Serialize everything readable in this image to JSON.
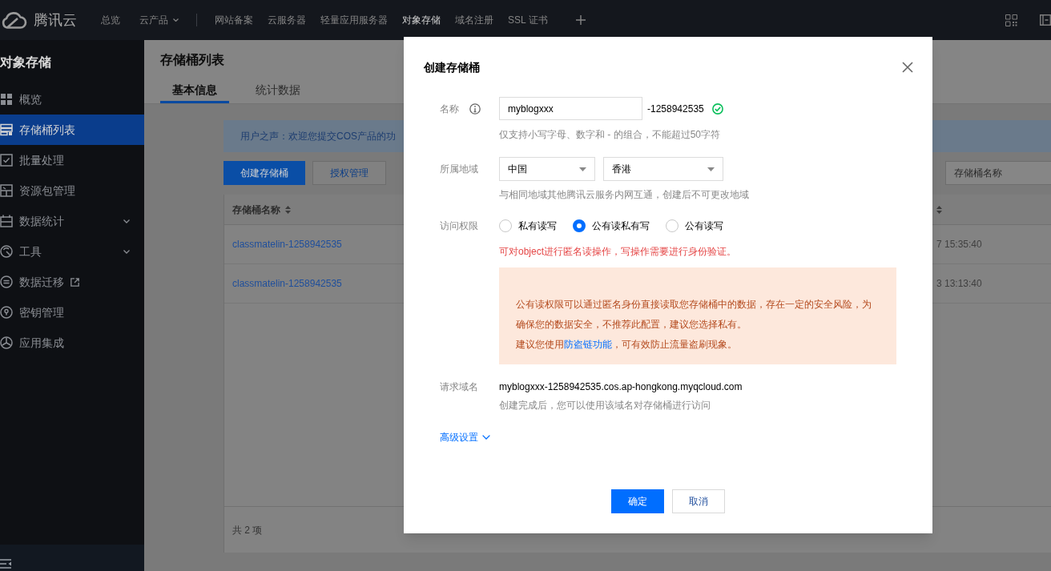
{
  "top_nav": {
    "logo": "腾讯云",
    "groups": [
      [
        {
          "label": "总览",
          "kind": "link",
          "selected": false
        },
        {
          "label": "云产品",
          "kind": "menu",
          "selected": false
        }
      ],
      [
        {
          "label": "网站备案",
          "kind": "link",
          "selected": false
        },
        {
          "label": "云服务器",
          "kind": "link",
          "selected": false
        },
        {
          "label": "轻量应用服务器",
          "kind": "link",
          "selected": false
        },
        {
          "label": "对象存储",
          "kind": "link",
          "selected": true
        },
        {
          "label": "域名注册",
          "kind": "link",
          "selected": false
        },
        {
          "label": "SSL 证书",
          "kind": "link",
          "selected": false
        }
      ]
    ]
  },
  "sidebar": {
    "title": "对象存储",
    "items": [
      {
        "label": "概览",
        "kind": "page",
        "selected": false
      },
      {
        "label": "存储桶列表",
        "kind": "page",
        "selected": true
      },
      {
        "label": "批量处理",
        "kind": "page",
        "selected": false
      },
      {
        "label": "资源包管理",
        "kind": "page",
        "selected": false
      },
      {
        "label": "数据统计",
        "kind": "group",
        "selected": false
      },
      {
        "label": "工具",
        "kind": "group",
        "selected": false
      },
      {
        "label": "数据迁移",
        "kind": "external",
        "selected": false
      },
      {
        "label": "密钥管理",
        "kind": "page",
        "selected": false
      },
      {
        "label": "应用集成",
        "kind": "page",
        "selected": false
      }
    ]
  },
  "page": {
    "title": "存储桶列表",
    "tabs": [
      {
        "label": "基本信息",
        "selected": true
      },
      {
        "label": "统计数据",
        "selected": false
      }
    ],
    "notice": "用户之声：欢迎您提交COS产品的功",
    "buttons": [
      {
        "label": "创建存储桶",
        "kind": "primary"
      },
      {
        "label": "授权管理",
        "kind": "default"
      }
    ],
    "search": {
      "placeholder": "存储桶名称"
    },
    "table": {
      "columns": [
        {
          "label": "存储桶名称",
          "sortable": true
        },
        {
          "sortable": true
        }
      ],
      "rows": [
        {
          "cells": [
            "classmatelin-1258942535",
            "7 15:35:40"
          ]
        },
        {
          "cells": [
            "classmatelin-1258942535",
            "3 13:13:40"
          ]
        }
      ]
    },
    "footer": "共 2 项"
  },
  "dialog": {
    "title": "创建存储桶",
    "name": {
      "label": "名称",
      "value": "myblogxxx",
      "suffix": "-1258942535",
      "valid": true,
      "hint": "仅支持小写字母、数字和 - 的组合，不能超过50字符"
    },
    "region": {
      "label": "所属地域",
      "selects": [
        "中国",
        "香港"
      ],
      "hint": "与相同地域其他腾讯云服务内网互通，创建后不可更改地域"
    },
    "access": {
      "label": "访问权限",
      "options": [
        {
          "label": "私有读写",
          "selected": false
        },
        {
          "label": "公有读私有写",
          "selected": true
        },
        {
          "label": "公有读写",
          "selected": false
        }
      ],
      "note": "可对object进行匿名读操作，写操作需要进行身份验证。",
      "warning": {
        "message": "公有读权限可以通过匿名身份直接读取您存储桶中的数据，存在一定的安全风险，为确保您的数据安全，不推荐此配置，建议您选择私有。",
        "tip": {
          "before": "建议您使用",
          "link": "防盗链功能",
          "after": "，可有效防止流量盗刷现象。"
        }
      }
    },
    "domain": {
      "label": "请求域名",
      "value": "myblogxxx-1258942535.cos.ap-hongkong.myqcloud.com",
      "hint": "创建完成后，您可以使用该域名对存储桶进行访问"
    },
    "advanced": {
      "label": "高级设置",
      "expanded": false
    },
    "buttons": [
      {
        "label": "确定",
        "kind": "primary"
      },
      {
        "label": "取消",
        "kind": "default"
      }
    ]
  }
}
